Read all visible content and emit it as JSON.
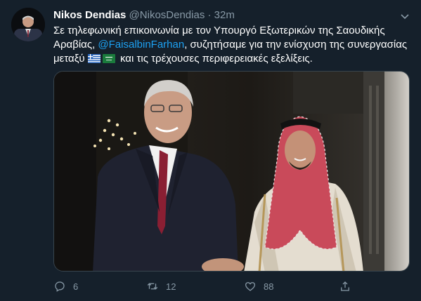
{
  "tweet": {
    "author_name": "Nikos Dendias",
    "author_handle": "@NikosDendias",
    "separator": "·",
    "timestamp": "32m",
    "text_part1": "Σε τηλεφωνική επικοινωνία με τον Υπουργό Εξωτερικών της Σαουδικής Αραβίας, ",
    "mention": "@FaisalbinFarhan",
    "text_part2": ", συζητήσαμε για την ενίσχυση της συνεργασίας μεταξύ ",
    "text_part3": " και τις τρέχουσες περιφερειακές εξελίξεις.",
    "flags": [
      "greece-flag",
      "saudi-arabia-flag"
    ]
  },
  "actions": {
    "reply_count": "6",
    "retweet_count": "12",
    "like_count": "88"
  },
  "icons": [
    "reply-icon",
    "retweet-icon",
    "like-icon",
    "share-icon",
    "chevron-down-icon"
  ],
  "colors": {
    "background": "#15202b",
    "secondary_text": "#8899a6",
    "link": "#1da1f2"
  }
}
